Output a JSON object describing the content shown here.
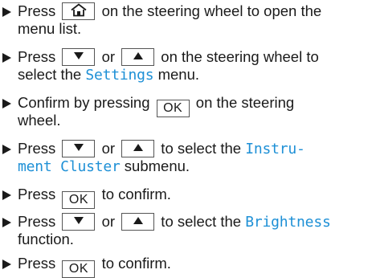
{
  "colors": {
    "text": "#1a1a1a",
    "highlight": "#1e90d6",
    "key_border": "#555555"
  },
  "icons": {
    "bullet": "right-pointing-triangle",
    "home_key": "home-icon",
    "down_key": "down-arrow-icon",
    "up_key": "up-arrow-icon"
  },
  "keys": {
    "ok": "OK"
  },
  "steps": [
    {
      "line1_before": "Press ",
      "line1_after": " on the steering wheel to open the",
      "line2": "menu list."
    },
    {
      "line1_before": "Press ",
      "line1_or": " or ",
      "line1_after": " on the steering wheel to",
      "line2_before": "select the ",
      "line2_highlight": "Settings",
      "line2_after": " menu."
    },
    {
      "line1_before": "Confirm by pressing ",
      "line1_after": " on the steering",
      "line2": "wheel."
    },
    {
      "line1_before": "Press ",
      "line1_or": " or ",
      "line1_after": " to select the ",
      "line1_highlight": "Instru-",
      "line2_highlight": "ment Cluster",
      "line2_after": " submenu."
    },
    {
      "line1_before": "Press ",
      "line1_after": " to confirm."
    },
    {
      "line1_before": "Press ",
      "line1_or": " or ",
      "line1_after": " to select the ",
      "line1_highlight": "Brightness",
      "line2": "function."
    },
    {
      "line1_before": "Press ",
      "line1_after": " to confirm."
    }
  ]
}
